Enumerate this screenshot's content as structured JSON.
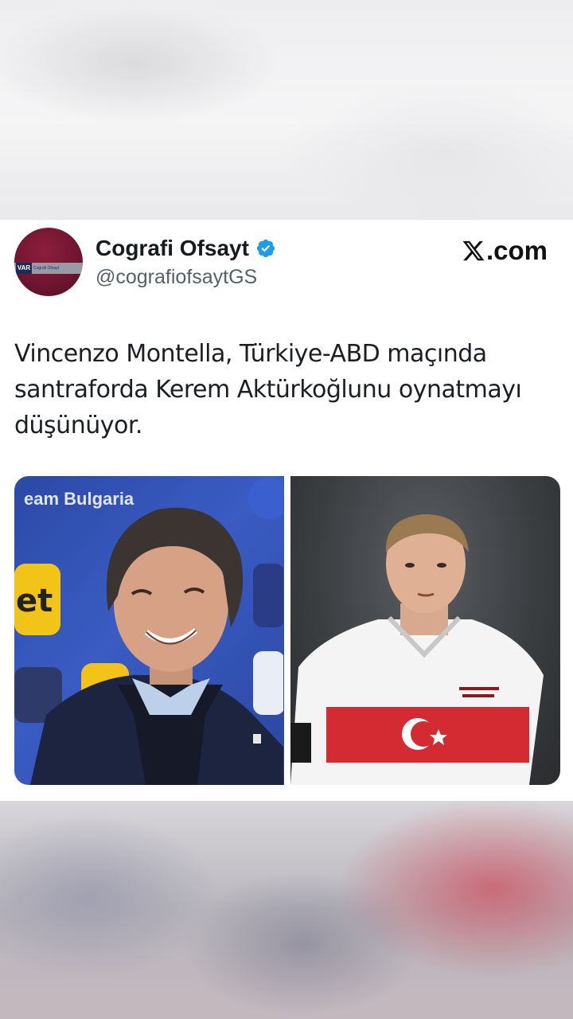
{
  "tweet": {
    "display_name": "Cografi Ofsayt",
    "handle": "@cografiofsaytGS",
    "verified": true,
    "avatar_tag": "VAR",
    "avatar_caption": "Cografi Ofsayt",
    "source": ".com",
    "source_icon": "x-logo-icon",
    "text": "Vincenzo Montella, Türkiye-ABD maçında santraforda Kerem Aktürkoğlunu oynatmayı düşünüyor.",
    "media": [
      {
        "alt_name": "photo-vincenzo-montella",
        "overlay_text": "eam Bulgaria"
      },
      {
        "alt_name": "photo-kerem-akturkoglu",
        "overlay_text": ""
      }
    ]
  },
  "colors": {
    "brand": "#8e1e3c",
    "verified": "#1d9bf0",
    "text": "#1b1f24",
    "handle": "#55606b"
  }
}
